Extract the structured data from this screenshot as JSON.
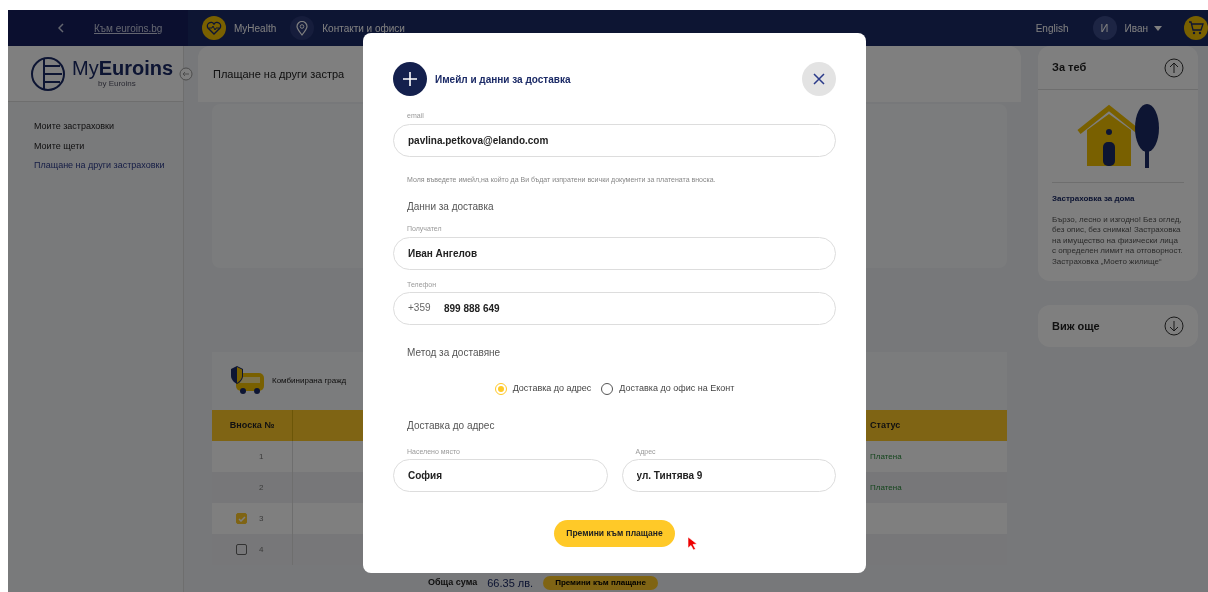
{
  "topbar": {
    "back_link": "Към euroins.bg",
    "links": [
      {
        "label": "MyHealth"
      },
      {
        "label": "Контакти и офиси"
      }
    ],
    "language": "English",
    "user": {
      "initial": "И",
      "name": "Иван"
    }
  },
  "sidebar": {
    "logo": "My**Euroins**",
    "logo_sub": "by Euroins",
    "items": [
      {
        "label": "Моите застраховки",
        "selected": false
      },
      {
        "label": "Моите щети",
        "selected": false
      },
      {
        "label": "Плащане на други застраховки",
        "selected": true
      }
    ]
  },
  "main": {
    "title": "Плащане на други застра",
    "policy": {
      "name": "Комбинирана гражд"
    },
    "table": {
      "columns": [
        "Вноска №",
        "Статус"
      ],
      "rows": [
        {
          "kind": "plain",
          "number": "1",
          "status": "Платена"
        },
        {
          "kind": "plain",
          "number": "2",
          "status": "Платена"
        },
        {
          "kind": "checkbox",
          "checked": true,
          "number": "3"
        },
        {
          "kind": "checkbox",
          "checked": false,
          "number": "4"
        }
      ]
    },
    "total_label": "Обща сума",
    "total": "66.35 лв.",
    "pay_button": "Премини към плащане"
  },
  "promo": {
    "title": "За теб",
    "card_title": "Застраховка за дома",
    "text": "Бързо, лесно и изгодно! Без оглед, без опис, без снимка! Застраховка на имущество на физически лица с определен лимит на отговорност. Застраховка „Моето жилище“",
    "more": "Виж още"
  },
  "modal": {
    "title": "Имейл и данни за доставка",
    "email": {
      "label": "email",
      "value": "pavlina.petkova@elando.com"
    },
    "email_hint": "Моля въведете имейл,на който да Ви бъдат изпратени всички документи за платената вноска.",
    "delivery_heading": "Данни за доставка",
    "recipient": {
      "label": "Получател",
      "value": "Иван Ангелов"
    },
    "phone": {
      "label": "Телефон",
      "prefix": "+359",
      "value": "899 888 649"
    },
    "method_heading": "Метод за доставяне",
    "methods": [
      {
        "label": "Доставка до адрес",
        "selected": true
      },
      {
        "label": "Доставка до офис на Еконт",
        "selected": false
      }
    ],
    "address_heading": "Доставка до адрес",
    "city": {
      "label": "Населено място",
      "value": "София"
    },
    "address": {
      "label": "Адрес",
      "value": "ул. Тинтява 9"
    },
    "submit": "Премини към плащане"
  }
}
